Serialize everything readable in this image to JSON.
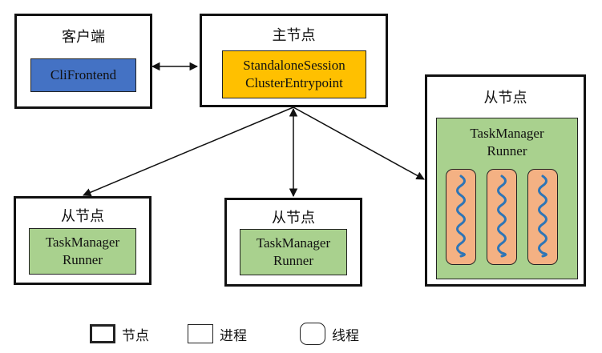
{
  "client": {
    "title": "客户端",
    "process": "CliFrontend"
  },
  "master": {
    "title": "主节点",
    "process_lines": [
      "StandaloneSession",
      "ClusterEntrypoint"
    ]
  },
  "worker_right": {
    "title": "从节点",
    "process_lines": [
      "TaskManager",
      "Runner"
    ],
    "thread_count": 3
  },
  "worker_left": {
    "title": "从节点",
    "process_lines": [
      "TaskManager",
      "Runner"
    ]
  },
  "worker_middle": {
    "title": "从节点",
    "process_lines": [
      "TaskManager",
      "Runner"
    ]
  },
  "legend": {
    "node": "节点",
    "process": "进程",
    "thread": "线程"
  },
  "colors": {
    "client_process": "#4472c4",
    "master_process": "#ffc000",
    "worker_process": "#a9d18e",
    "thread": "#f4b183",
    "thread_line": "#2e75b6"
  }
}
